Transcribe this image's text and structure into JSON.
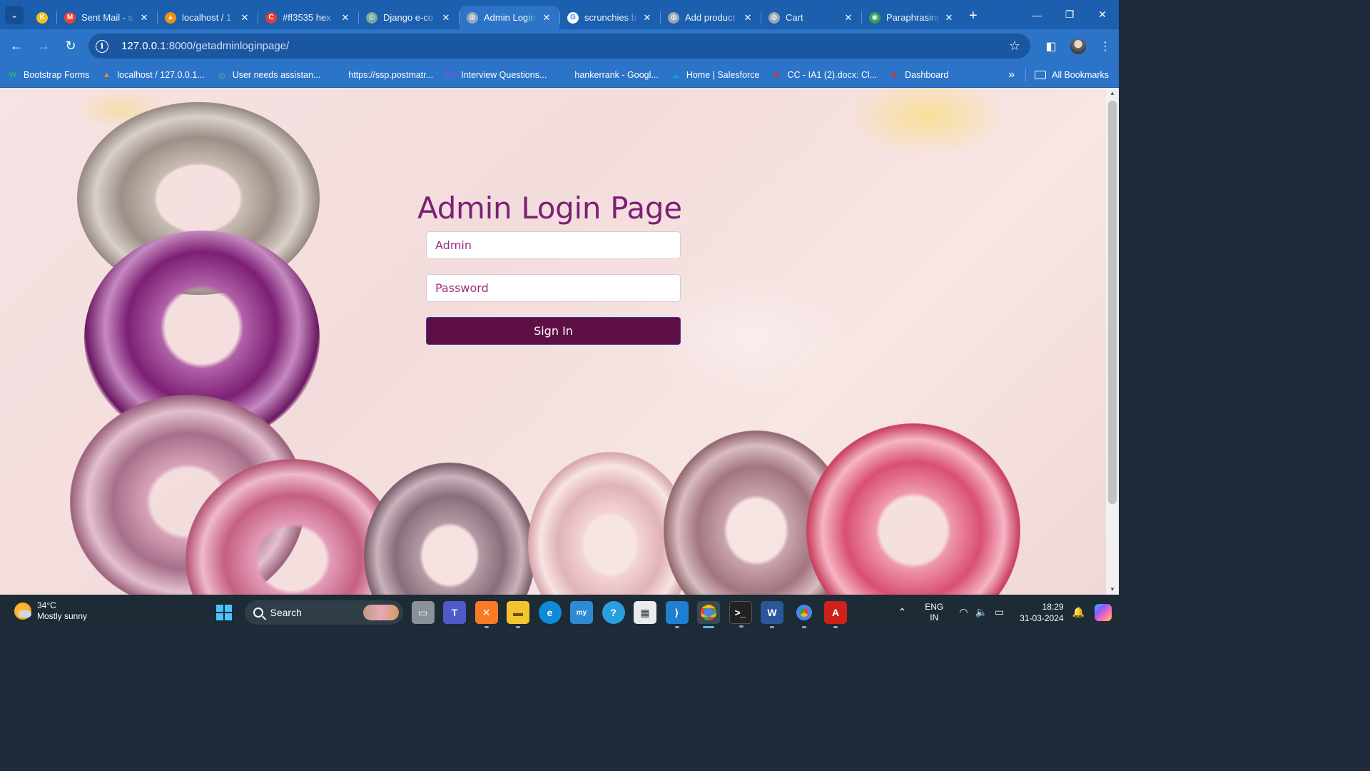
{
  "browser": {
    "tabs": [
      {
        "title": "",
        "favicon_color": "#f2c21b",
        "favicon_text": "K",
        "active": false
      },
      {
        "title": "Sent Mail - s",
        "favicon_color": "#ea4335",
        "favicon_text": "M",
        "active": false
      },
      {
        "title": "localhost / 1",
        "favicon_color": "#f29111",
        "favicon_text": "▲",
        "active": false
      },
      {
        "title": "#ff3535 hex",
        "favicon_color": "#e23b3b",
        "favicon_text": "C",
        "active": false
      },
      {
        "title": "Django e-co",
        "favicon_color": "#74aa9c",
        "favicon_text": "◎",
        "active": false
      },
      {
        "title": "Admin Login",
        "favicon_color": "#9aa7b8",
        "favicon_text": "◍",
        "active": true
      },
      {
        "title": "scrunchies b",
        "favicon_color": "#ffffff",
        "favicon_text": "G",
        "active": false
      },
      {
        "title": "Add product",
        "favicon_color": "#9aa7b8",
        "favicon_text": "◍",
        "active": false
      },
      {
        "title": "Cart",
        "favicon_color": "#9aa7b8",
        "favicon_text": "◍",
        "active": false
      },
      {
        "title": "Paraphrasing",
        "favicon_color": "#3a9e5d",
        "favicon_text": "◉",
        "active": false
      }
    ],
    "url_host": "127.0.0.1",
    "url_path": ":8000/getadminloginpage/",
    "bookmarks": [
      {
        "label": "Bootstrap Forms",
        "icon": "W",
        "color": "#1fb47c"
      },
      {
        "label": "localhost / 127.0.0.1...",
        "icon": "▲",
        "color": "#f29111"
      },
      {
        "label": "User needs assistan...",
        "icon": "◎",
        "color": "#74aa9c"
      },
      {
        "label": "https://ssp.postmatr...",
        "icon": "◍",
        "color": "#2b74c8"
      },
      {
        "label": "Interview Questions...",
        "icon": "Fn",
        "color": "#8a4ae0"
      },
      {
        "label": "hankerrank - Googl...",
        "icon": "◍",
        "color": "#2b74c8"
      },
      {
        "label": "Home | Salesforce",
        "icon": "☁",
        "color": "#0aa1e0"
      },
      {
        "label": "CC - IA1 (2).docx: Cl...",
        "icon": "✺",
        "color": "#d8333a"
      },
      {
        "label": "Dashboard",
        "icon": "✺",
        "color": "#d8333a"
      }
    ],
    "all_bookmarks_label": "All Bookmarks"
  },
  "login": {
    "heading": "Admin Login Page",
    "username_placeholder": "Admin",
    "password_placeholder": "Password",
    "submit_label": "Sign In",
    "heading_color": "#7b2075",
    "button_color": "#5e0f45"
  },
  "taskbar": {
    "weather_temp": "34°C",
    "weather_desc": "Mostly sunny",
    "search_label": "Search",
    "lang_line1": "ENG",
    "lang_line2": "IN",
    "time": "18:29",
    "date": "31-03-2024"
  }
}
